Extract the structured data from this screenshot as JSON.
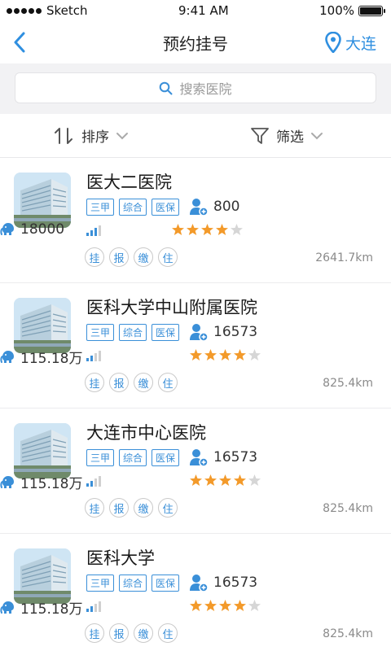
{
  "status_bar": {
    "carrier": "Sketch",
    "time": "9:41 AM",
    "battery": "100%"
  },
  "nav": {
    "title": "预约挂号",
    "city": "大连",
    "back_icon": "chevron-left-icon",
    "location_icon": "location-pin-icon"
  },
  "search": {
    "placeholder": "搜索医院",
    "icon": "search-icon"
  },
  "filter": {
    "sort_label": "排序",
    "filter_label": "筛选"
  },
  "colors": {
    "accent": "#2f8fe0",
    "star": "#f39a2a",
    "star_off": "#d6d6d6"
  },
  "hospitals": [
    {
      "name": "医大二医院",
      "tags": [
        "三甲",
        "综合",
        "医保"
      ],
      "visits": "800",
      "fans": "18000",
      "rating": 4,
      "signal": 3,
      "services": [
        "挂",
        "报",
        "缴",
        "住"
      ],
      "distance": "2641.7km"
    },
    {
      "name": "医科大学中山附属医院",
      "tags": [
        "三甲",
        "综合",
        "医保"
      ],
      "visits": "16573",
      "fans": "115.18万",
      "rating": 4,
      "signal": 2,
      "services": [
        "挂",
        "报",
        "缴",
        "住"
      ],
      "distance": "825.4km"
    },
    {
      "name": "大连市中心医院",
      "tags": [
        "三甲",
        "综合",
        "医保"
      ],
      "visits": "16573",
      "fans": "115.18万",
      "rating": 4,
      "signal": 2,
      "services": [
        "挂",
        "报",
        "缴",
        "住"
      ],
      "distance": "825.4km"
    },
    {
      "name": "医科大学",
      "tags": [
        "三甲",
        "综合",
        "医保"
      ],
      "visits": "16573",
      "fans": "115.18万",
      "rating": 4,
      "signal": 2,
      "services": [
        "挂",
        "报",
        "缴",
        "住"
      ],
      "distance": "825.4km"
    }
  ]
}
